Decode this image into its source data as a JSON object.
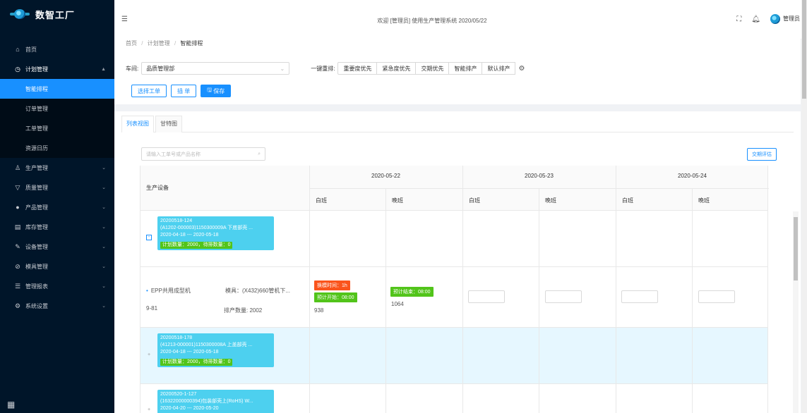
{
  "app": {
    "logo_text": "数智工厂"
  },
  "header": {
    "welcome": "欢迎 [管理员] 使用生产管理系统 2020/05/22",
    "user": "管理员",
    "fold_icon": "menu-fold-icon",
    "fullscreen_icon": "fullscreen-icon",
    "bell_icon": "bell-icon"
  },
  "sidebar": {
    "items": [
      {
        "label": "首页",
        "icon": "home-icon"
      },
      {
        "label": "计划管理",
        "icon": "clock-icon"
      },
      {
        "label": "生产管理",
        "icon": "people-icon"
      },
      {
        "label": "质量管理",
        "icon": "funnel-icon"
      },
      {
        "label": "产品管理",
        "icon": "dot-icon"
      },
      {
        "label": "库存管理",
        "icon": "box-icon"
      },
      {
        "label": "设备管理",
        "icon": "wrench-icon"
      },
      {
        "label": "模具管理",
        "icon": "compass-icon"
      },
      {
        "label": "管理报表",
        "icon": "report-icon"
      },
      {
        "label": "系统设置",
        "icon": "settings-icon"
      }
    ],
    "sub_items": [
      {
        "label": "智能排程"
      },
      {
        "label": "订单管理"
      },
      {
        "label": "工单管理"
      },
      {
        "label": "资源日历"
      }
    ]
  },
  "breadcrumb": {
    "home": "首页",
    "sep": "/",
    "plan": "计划管理",
    "current": "智能排程"
  },
  "toolbar": {
    "workshop_label": "车间:",
    "workshop_value": "品质管理部",
    "onekey_label": "一键重排:",
    "sort_options": [
      "重要度优先",
      "紧急度优先",
      "交期优先",
      "智能排产",
      "默认排产"
    ],
    "select_order": "选择工单",
    "insert_order": "插 单",
    "save": "保存"
  },
  "tabs": [
    "列表视图",
    "甘特图"
  ],
  "search": {
    "placeholder": "请输入工单号或产品名称"
  },
  "eval_button": "交期评估",
  "table": {
    "device_header": "生产设备",
    "dates": [
      "2020-05-22",
      "2020-05-23",
      "2020-05-24"
    ],
    "shifts": [
      "白班",
      "晚班",
      "白班",
      "晚班",
      "白班",
      "晚班"
    ],
    "group1": {
      "expander": "-",
      "line1": "20200518-124",
      "line2": "(A1202-000003)1150300009A 下底部壳 ...",
      "line3": "2020-04-18 --- 2020-05-18",
      "qty": "计划数量：2000，待排数量：0"
    },
    "device_row": {
      "name": "EPP共用成型机",
      "mold": "模具：(X432)660管机下...",
      "code": "9-81",
      "sched_qty": "排产数量: 2002",
      "changeover": "换模时间：1h",
      "start": "预计开始：08:00",
      "end": "预计结束：08:00",
      "val1": "938",
      "val2": "1064"
    },
    "group2": {
      "expander": "+",
      "line1": "20200518-178",
      "line2": "(41213-000001)1150300008A 上盖部壳 ...",
      "line3": "2020-04-18 --- 2020-05-18",
      "qty": "计划数量：2000，待排数量：0"
    },
    "group3": {
      "expander": "+",
      "line1": "20200520-1-127",
      "line2": "(16322000000394)包装部壳上(RoHS) W...",
      "line3": "2020-04-20 --- 2020-05-20"
    }
  }
}
